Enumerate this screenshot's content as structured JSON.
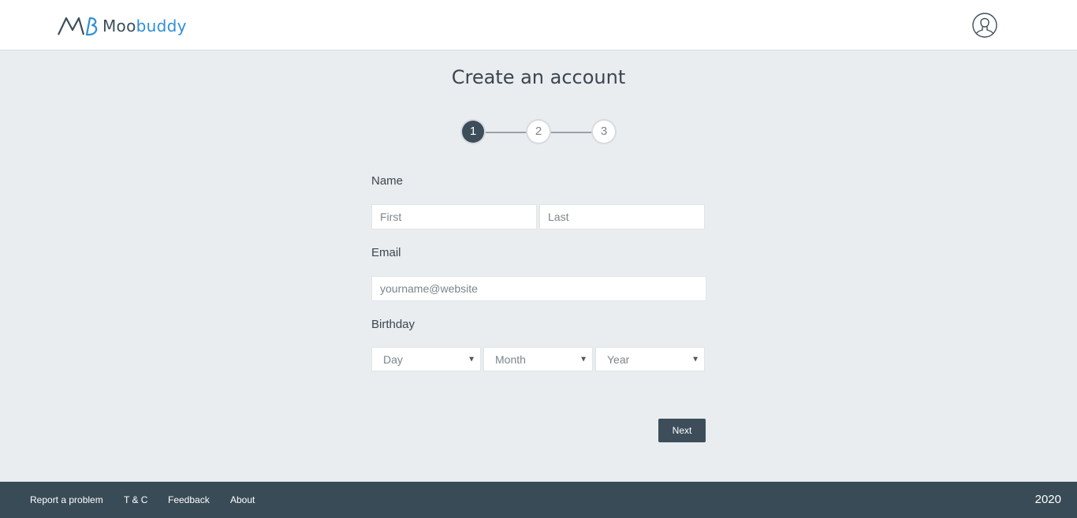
{
  "header": {
    "logo_text_1": "Moo",
    "logo_text_2": "buddy",
    "avatar_icon": "user-circle-icon",
    "brand_colors": {
      "dark": "#3d4e5a",
      "accent": "#2f8fd8"
    }
  },
  "page": {
    "title": "Create an account"
  },
  "stepper": {
    "steps": [
      "1",
      "2",
      "3"
    ],
    "active_step": 1
  },
  "form": {
    "name_label": "Name",
    "first_placeholder": "First",
    "last_placeholder": "Last",
    "email_label": "Email",
    "email_placeholder": "yourname@website",
    "birthday_label": "Birthday",
    "day_placeholder": "Day",
    "month_placeholder": "Month",
    "year_placeholder": "Year",
    "next_label": "Next"
  },
  "footer": {
    "links": [
      "Report a problem",
      "T & C",
      "Feedback",
      "About"
    ],
    "year": "2020",
    "background": "#394b57"
  }
}
